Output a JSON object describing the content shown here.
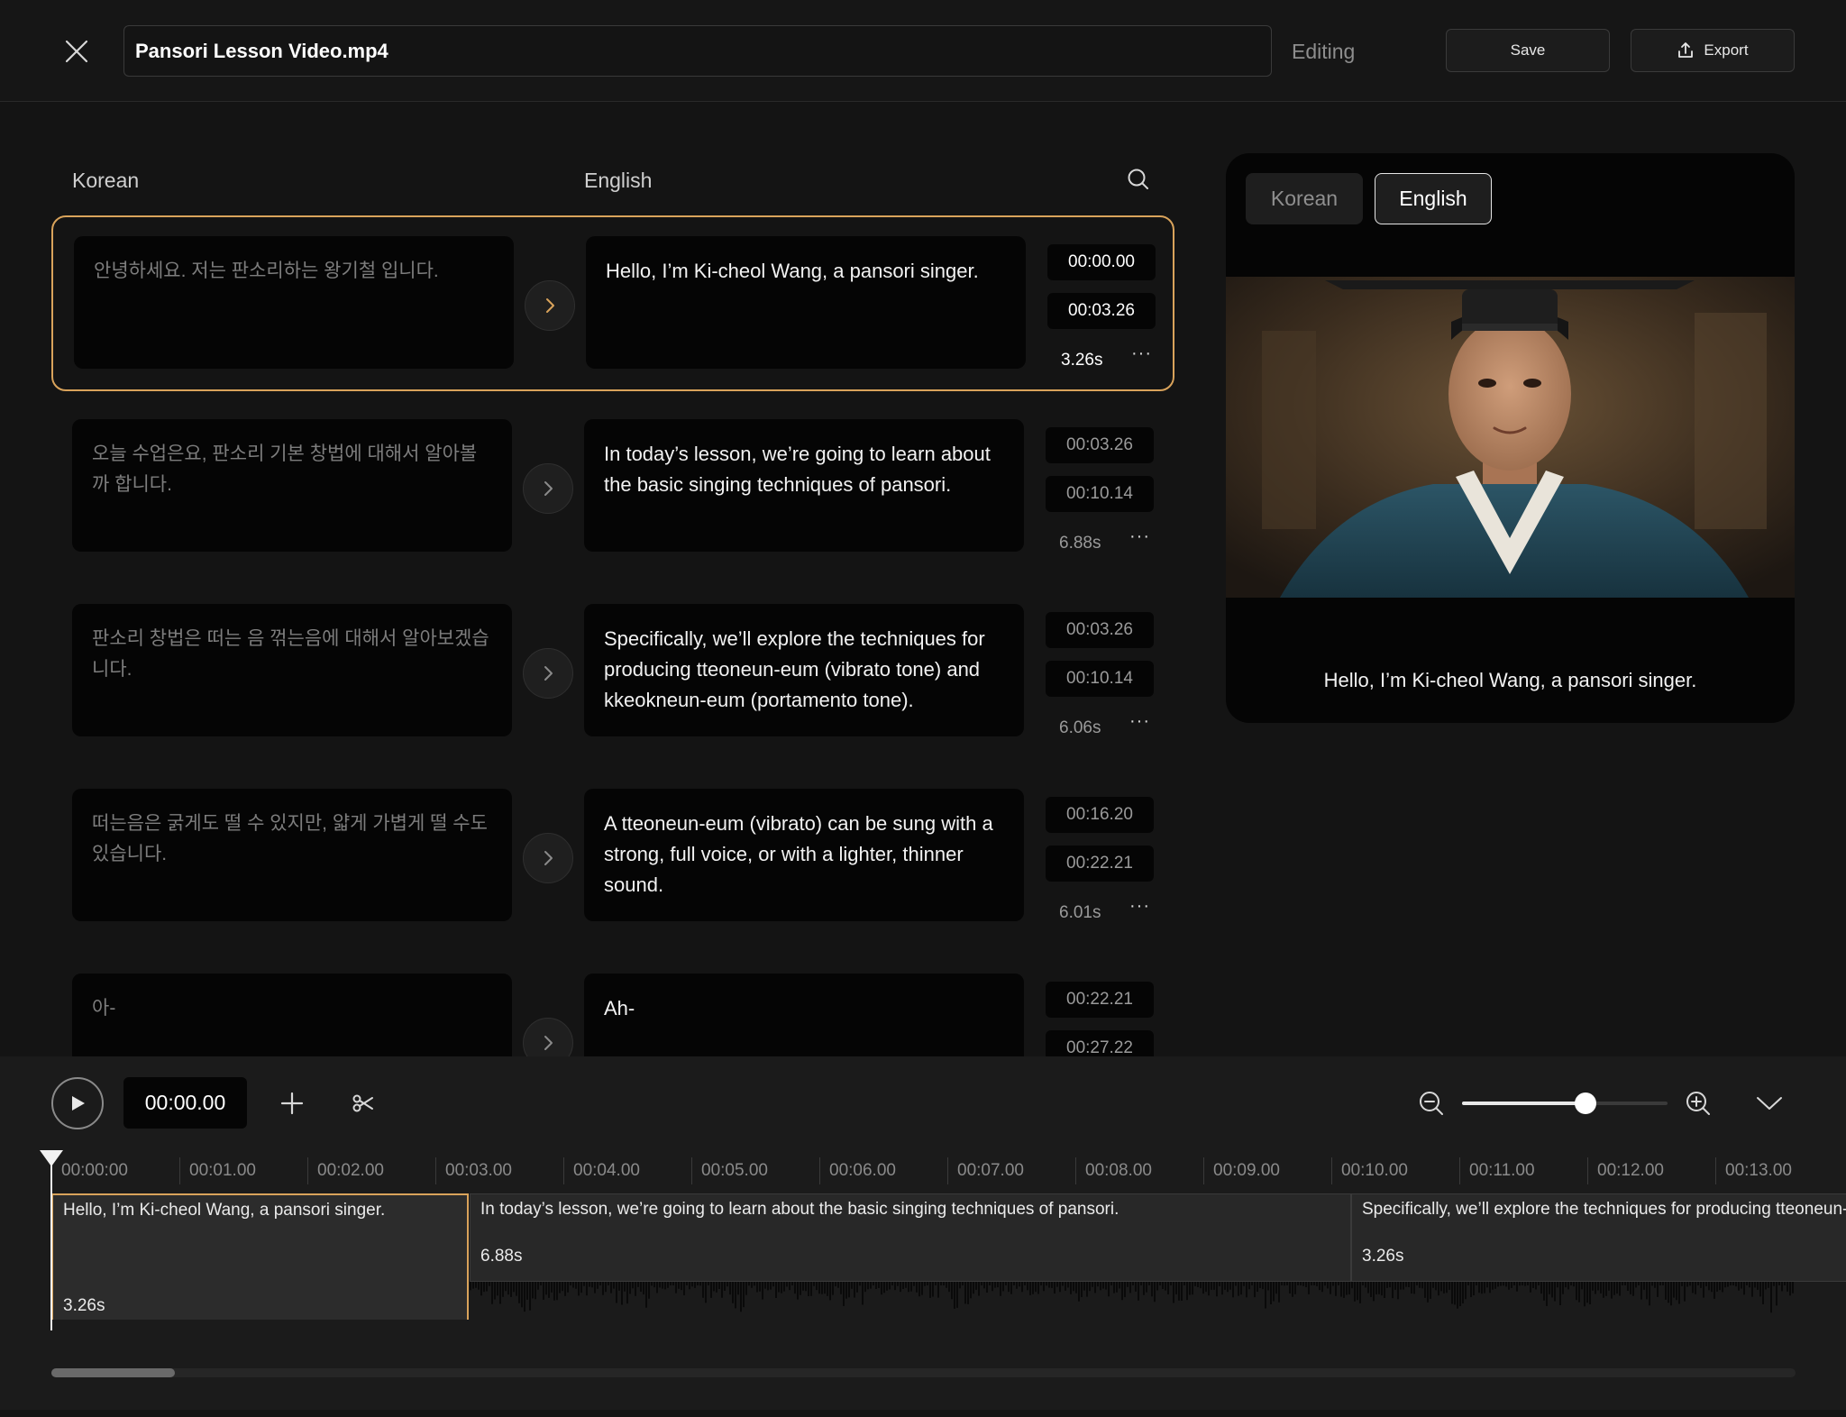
{
  "header": {
    "file_name": "Pansori Lesson Video.mp4",
    "status": "Editing",
    "save_label": "Save",
    "export_label": "Export"
  },
  "columns": {
    "source_label": "Korean",
    "target_label": "English"
  },
  "segments": [
    {
      "korean": "안녕하세요. 저는 판소리하는 왕기철 입니다.",
      "english": "Hello, I’m Ki-cheol Wang, a pansori singer.",
      "start": "00:00.00",
      "end": "00:03.26",
      "duration": "3.26s"
    },
    {
      "korean": "오늘 수업은요, 판소리 기본 창법에 대해서 알아볼까 합니다.",
      "english": "In today’s lesson, we’re going to learn about the basic singing techniques of pansori.",
      "start": "00:03.26",
      "end": "00:10.14",
      "duration": "6.88s"
    },
    {
      "korean": "판소리 창법은 떠는 음 꺾는음에 대해서 알아보겠습니다.",
      "english": "Specifically, we’ll explore the techniques for producing tteoneun-eum (vibrato tone) and kkeokneun-eum (portamento tone).",
      "start": "00:03.26",
      "end": "00:10.14",
      "duration": "6.06s"
    },
    {
      "korean": "떠는음은 굵게도 떨 수 있지만, 얇게 가볍게 떨 수도 있습니다.",
      "english": "A tteoneun-eum (vibrato) can be sung with a strong, full voice, or with a lighter, thinner sound.",
      "start": "00:16.20",
      "end": "00:22.21",
      "duration": "6.01s"
    },
    {
      "korean": "아-",
      "english": "Ah-",
      "start": "00:22.21",
      "end": "00:27.22",
      "duration": ""
    }
  ],
  "more_label": "···",
  "preview": {
    "tab_korean": "Korean",
    "tab_english": "English",
    "caption": "Hello, I’m Ki-cheol Wang, a pansori singer."
  },
  "timeline": {
    "current_time": "00:00.00",
    "zoom_level": 0.6,
    "ruler_ticks": [
      "00:00:00",
      "00:01.00",
      "00:02.00",
      "00:03.00",
      "00:04.00",
      "00:05.00",
      "00:06.00",
      "00:07.00",
      "00:08.00",
      "00:09.00",
      "00:10.00",
      "00:11.00",
      "00:12.00",
      "00:13.00"
    ],
    "clips": [
      {
        "text": "Hello, I’m Ki-cheol Wang, a pansori singer.",
        "duration": "3.26s"
      },
      {
        "text": "In today’s lesson, we’re going to learn about the basic singing techniques of pansori.",
        "duration": "6.88s"
      },
      {
        "text": "Specifically, we’ll explore the techniques for producing tteoneun-eum (vibrato tone) and kkeokneun-eum (portamento tone).",
        "duration": "3.26s"
      }
    ]
  },
  "colors": {
    "accent": "#d9a35b",
    "background": "#141414",
    "panel": "#050505"
  },
  "icons": [
    "close-icon",
    "export-icon",
    "search-icon",
    "chevron-right-icon",
    "play-icon",
    "plus-icon",
    "scissors-icon",
    "zoom-out-icon",
    "zoom-in-icon",
    "chevron-down-icon"
  ]
}
